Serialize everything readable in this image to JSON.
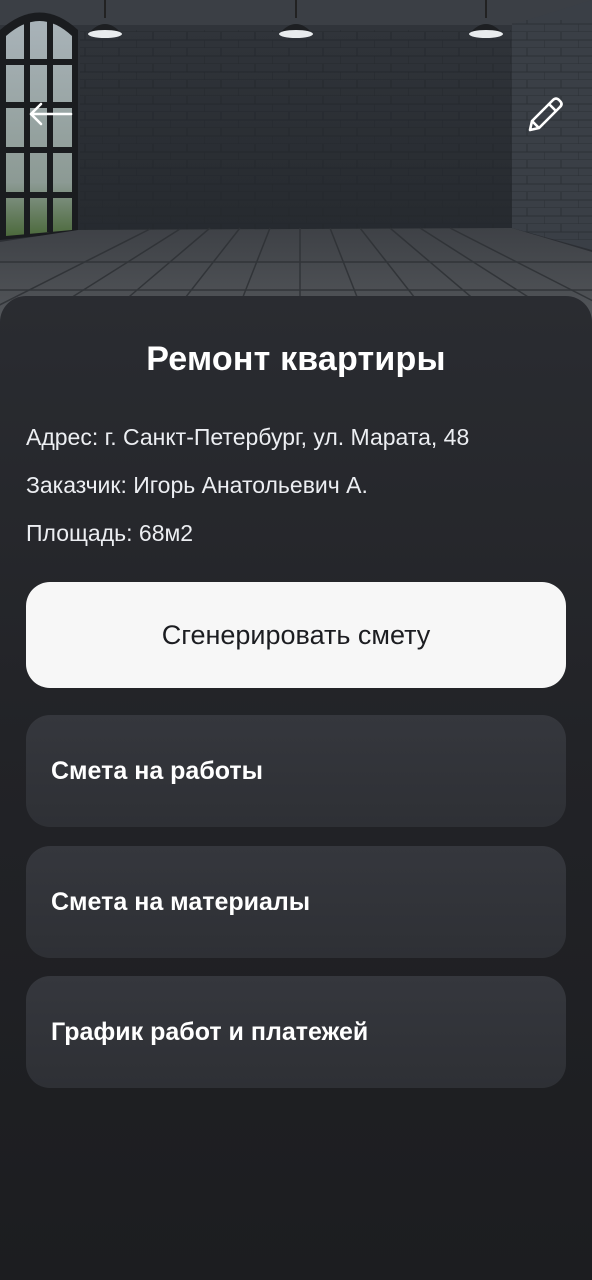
{
  "header": {
    "back_icon": "arrow-left-icon",
    "edit_icon": "pencil-icon"
  },
  "project": {
    "title": "Ремонт квартиры",
    "address": "Адрес: г. Санкт-Петербург, ул. Марата, 48",
    "client": "Заказчик: Игорь Анатольевич А.",
    "area": "Площадь: 68м2"
  },
  "actions": {
    "generate_label": "Сгенерировать смету",
    "items": [
      {
        "label": "Смета на работы"
      },
      {
        "label": "Смета на материалы"
      },
      {
        "label": "График работ и платежей"
      }
    ]
  },
  "colors": {
    "background": "#1e1f22",
    "card": "#33353a",
    "primary_button": "#f7f7f7",
    "text": "#ffffff"
  }
}
